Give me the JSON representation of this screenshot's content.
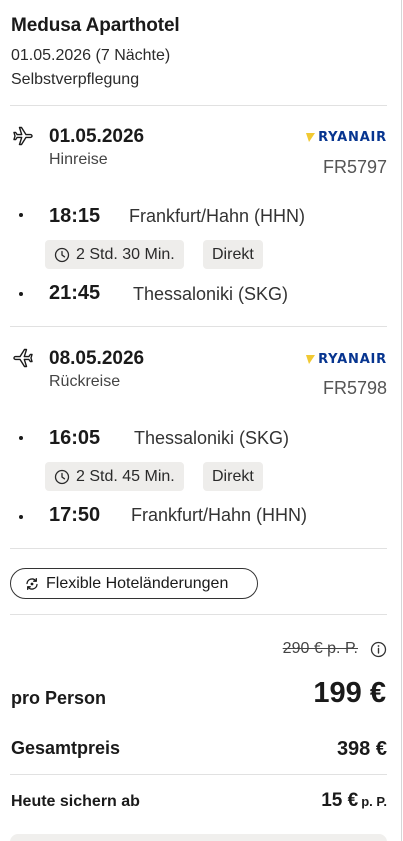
{
  "hotel": {
    "name": "Medusa Aparthotel",
    "dates": "01.05.2026 (7 Nächte)",
    "board": "Selbstverpflegung"
  },
  "outbound": {
    "icon": "plane-departure-icon",
    "date": "01.05.2026",
    "direction": "Hinreise",
    "airline": "RYANAIR",
    "flight_no": "FR5797",
    "dep_time": "18:15",
    "dep_place": "Frankfurt/Hahn (HHN)",
    "duration": "2 Std. 30 Min.",
    "type": "Direkt",
    "arr_time": "21:45",
    "arr_place": "Thessaloniki (SKG)"
  },
  "return": {
    "icon": "plane-arrival-icon",
    "date": "08.05.2026",
    "direction": "Rückreise",
    "airline": "RYANAIR",
    "flight_no": "FR5798",
    "dep_time": "16:05",
    "dep_place": "Thessaloniki (SKG)",
    "duration": "2 Std. 45 Min.",
    "type": "Direkt",
    "arr_time": "17:50",
    "arr_place": "Frankfurt/Hahn (HHN)"
  },
  "flex_button": {
    "label": "Flexible Hoteländerungen"
  },
  "pricing": {
    "old_price": "290 € p. P.",
    "per_person_label": "pro Person",
    "per_person_value": "199 €",
    "total_label": "Gesamtpreis",
    "total_value": "398 €",
    "today_label": "Heute sichern ab",
    "today_value": "15 €",
    "today_unit": "p. P."
  },
  "colors": {
    "brand_ryanair": "#073590",
    "chip_bg": "#eeedeb",
    "divider": "#e1e1e1"
  }
}
